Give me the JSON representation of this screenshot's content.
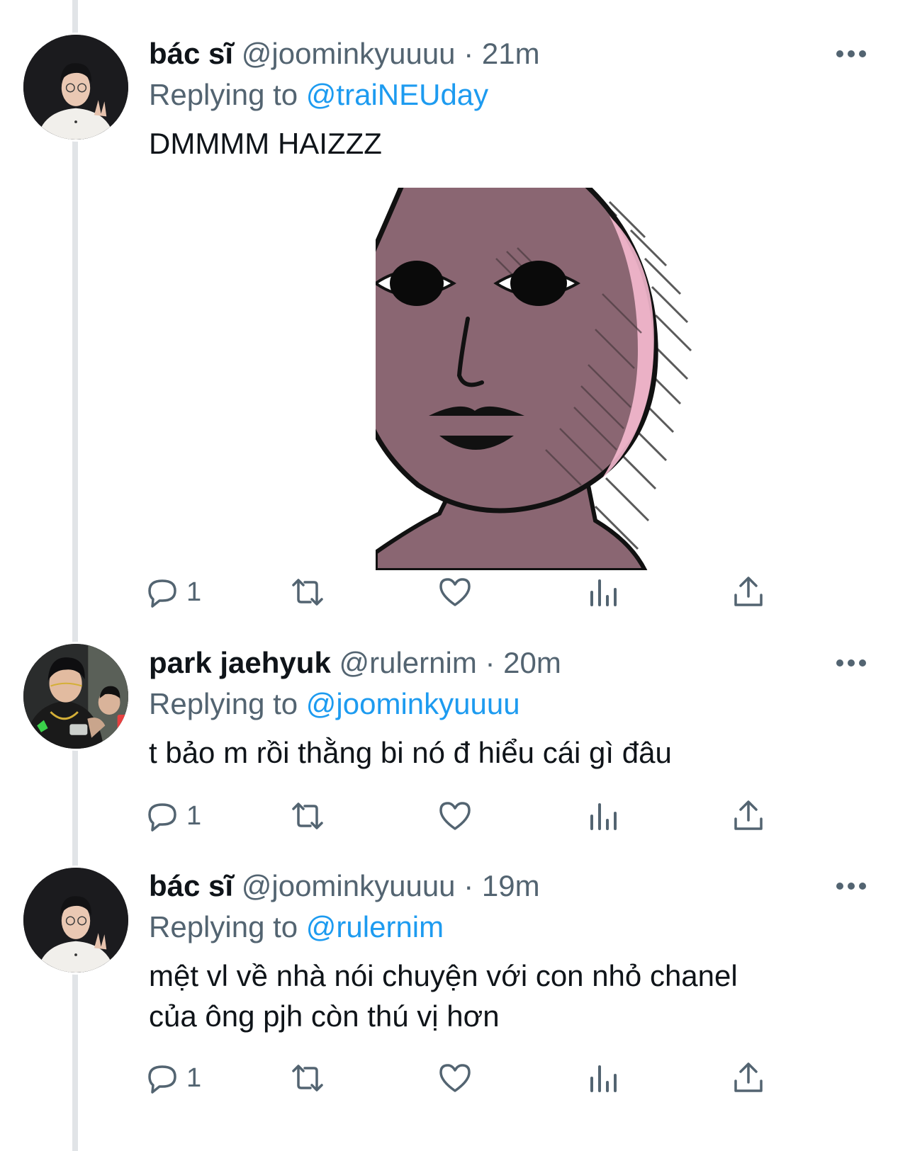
{
  "tweets": [
    {
      "display_name": "bác sĩ",
      "handle": "@joominkyuuuu",
      "dot": "·",
      "time": "21m",
      "replying_prefix": "Replying to",
      "replying_to": "@traiNEUday",
      "text": "DMMMM HAIZZZ",
      "has_image": true,
      "reply_count": "1"
    },
    {
      "display_name": "park jaehyuk",
      "handle": "@rulernim",
      "dot": "·",
      "time": "20m",
      "replying_prefix": "Replying to",
      "replying_to": "@joominkyuuuu",
      "text": "t bảo m rồi thằng bi nó đ hiểu cái gì đâu",
      "has_image": false,
      "reply_count": "1"
    },
    {
      "display_name": "bác sĩ",
      "handle": "@joominkyuuuu",
      "dot": "·",
      "time": "19m",
      "replying_prefix": "Replying to",
      "replying_to": "@rulernim",
      "text_line1": "mệt vl về nhà nói chuyện với con nhỏ chanel",
      "text_line2": "của ông pjh còn thú vị hơn",
      "has_image": false,
      "reply_count": "1"
    }
  ],
  "icons": {
    "reply": "reply-icon",
    "retweet": "retweet-icon",
    "like": "heart-icon",
    "analytics": "analytics-icon",
    "share": "share-icon",
    "more": "more-icon"
  },
  "colors": {
    "link": "#1d9bf0",
    "secondary_text": "#536471",
    "thread_line": "#e1e4e7",
    "sticker_face": "#8a6672",
    "sticker_highlight": "#f5b9cf"
  }
}
